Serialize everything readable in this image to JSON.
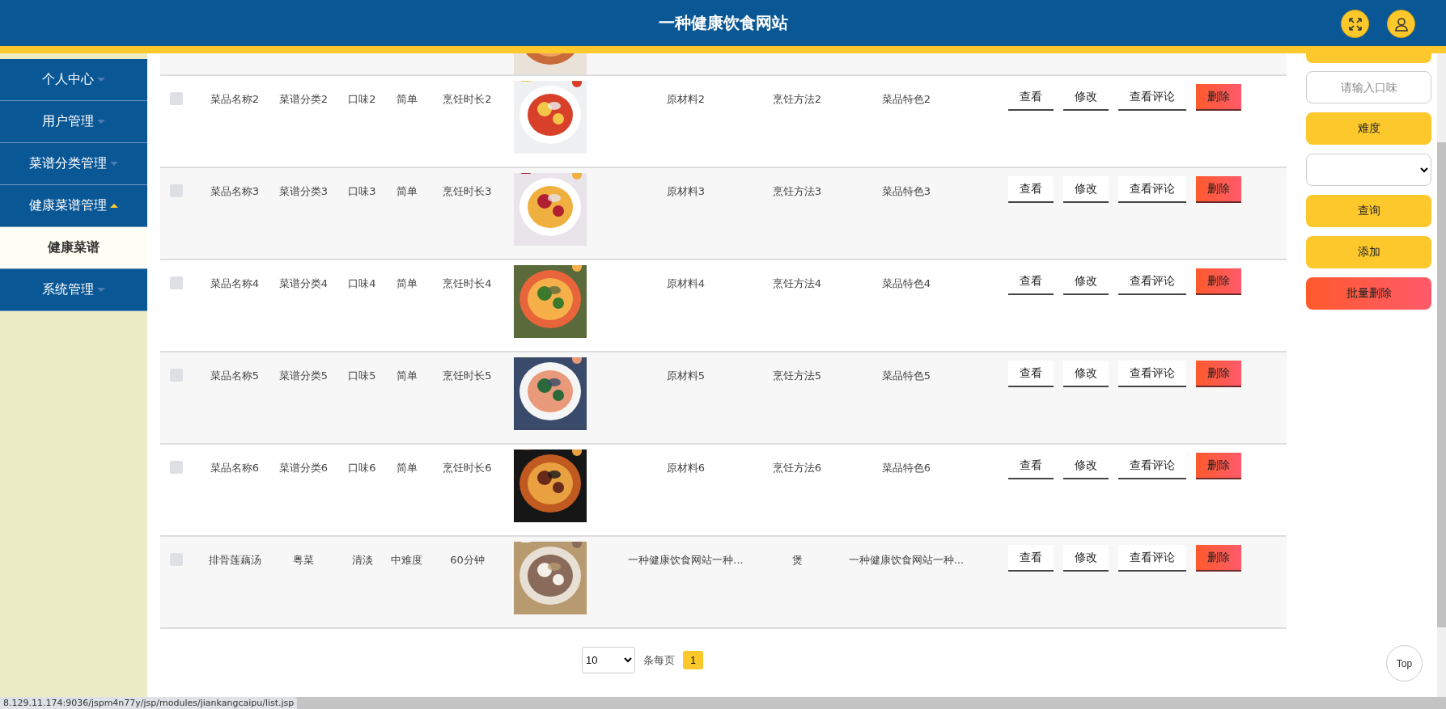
{
  "header": {
    "title": "一种健康饮食网站"
  },
  "sidebar": {
    "items": [
      {
        "label": "个人中心",
        "expanded": false
      },
      {
        "label": "用户管理",
        "expanded": false
      },
      {
        "label": "菜谱分类管理",
        "expanded": false
      },
      {
        "label": "健康菜谱管理",
        "expanded": true,
        "children": [
          {
            "label": "健康菜谱",
            "selected": true
          }
        ]
      },
      {
        "label": "系统管理",
        "expanded": false
      }
    ]
  },
  "table": {
    "rows": [
      {
        "kind": "cut"
      },
      {
        "kind": "full",
        "checked": false,
        "cells": [
          "菜品名称2",
          "菜谱分类2",
          "口味2",
          "简单",
          "烹饪时长2",
          "原材料2",
          "烹饪方法2",
          "菜品特色2"
        ],
        "actions": [
          "查看",
          "修改",
          "查看评论",
          "删除"
        ]
      },
      {
        "kind": "full",
        "checked": false,
        "cells": [
          "菜品名称3",
          "菜谱分类3",
          "口味3",
          "简单",
          "烹饪时长3",
          "原材料3",
          "烹饪方法3",
          "菜品特色3"
        ],
        "actions": [
          "查看",
          "修改",
          "查看评论",
          "删除"
        ]
      },
      {
        "kind": "full",
        "checked": false,
        "cells": [
          "菜品名称4",
          "菜谱分类4",
          "口味4",
          "简单",
          "烹饪时长4",
          "原材料4",
          "烹饪方法4",
          "菜品特色4"
        ],
        "actions": [
          "查看",
          "修改",
          "查看评论",
          "删除"
        ]
      },
      {
        "kind": "full",
        "checked": false,
        "cells": [
          "菜品名称5",
          "菜谱分类5",
          "口味5",
          "简单",
          "烹饪时长5",
          "原材料5",
          "烹饪方法5",
          "菜品特色5"
        ],
        "actions": [
          "查看",
          "修改",
          "查看评论",
          "删除"
        ]
      },
      {
        "kind": "full",
        "checked": false,
        "cells": [
          "菜品名称6",
          "菜谱分类6",
          "口味6",
          "简单",
          "烹饪时长6",
          "原材料6",
          "烹饪方法6",
          "菜品特色6"
        ],
        "actions": [
          "查看",
          "修改",
          "查看评论",
          "删除"
        ]
      },
      {
        "kind": "full",
        "checked": false,
        "cells": [
          "排骨莲藕汤",
          "粤菜",
          "清淡",
          "中难度",
          "60分钟",
          "一种健康饮食网站一种...",
          "煲",
          "一种健康饮食网站一种..."
        ],
        "actions": [
          "查看",
          "修改",
          "查看评论",
          "删除"
        ]
      }
    ]
  },
  "pagination": {
    "page_size": "10",
    "per_page_label": "条每页",
    "pages": [
      {
        "label": "1",
        "selected": true
      }
    ]
  },
  "filters": [
    {
      "kind": "cut"
    },
    {
      "kind": "input",
      "placeholder": "请输入口味"
    },
    {
      "kind": "label",
      "text": "难度"
    },
    {
      "kind": "select"
    },
    {
      "kind": "button",
      "text": "查询"
    },
    {
      "kind": "button",
      "text": "添加"
    },
    {
      "kind": "danger",
      "text": "批量删除"
    }
  ],
  "top_button": "Top",
  "status_bar": "8.129.11.174:9036/jspm4n77y/jsp/modules/jiankangcaipu/list.jsp"
}
